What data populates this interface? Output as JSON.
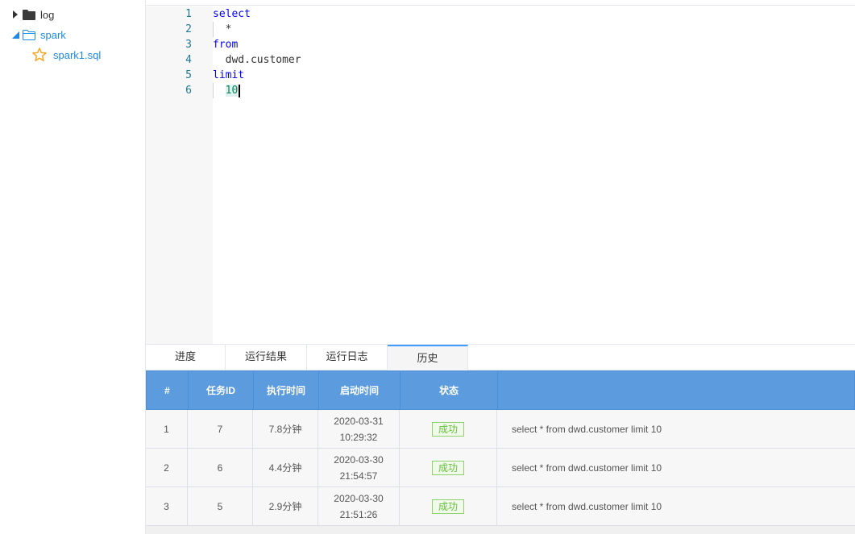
{
  "tree": {
    "items": [
      {
        "label": "log",
        "icon": "folder-filled-icon"
      },
      {
        "label": "spark",
        "icon": "folder-outline-icon"
      },
      {
        "label": "spark1.sql",
        "icon": "star-icon"
      }
    ]
  },
  "editor": {
    "line_numbers": [
      "1",
      "2",
      "3",
      "4",
      "5",
      "6"
    ],
    "lines": {
      "l1": "select",
      "l2": "  *",
      "l3": "from",
      "l4": "  dwd.customer",
      "l5": "limit",
      "l6_indent": "  ",
      "l6_value": "10"
    }
  },
  "tabs": [
    "进度",
    "运行结果",
    "运行日志",
    "历史"
  ],
  "active_tab": "历史",
  "table": {
    "headers": [
      "#",
      "任务ID",
      "执行时间",
      "启动时间",
      "状态",
      ""
    ],
    "rows": [
      {
        "idx": "1",
        "task_id": "7",
        "duration": "7.8分钟",
        "start_date": "2020-03-31",
        "start_time": "10:29:32",
        "status": "成功",
        "sql": "select * from dwd.customer limit 10"
      },
      {
        "idx": "2",
        "task_id": "6",
        "duration": "4.4分钟",
        "start_date": "2020-03-30",
        "start_time": "21:54:57",
        "status": "成功",
        "sql": "select * from dwd.customer limit 10"
      },
      {
        "idx": "3",
        "task_id": "5",
        "duration": "2.9分钟",
        "start_date": "2020-03-30",
        "start_time": "21:51:26",
        "status": "成功",
        "sql": "select * from dwd.customer limit 10"
      }
    ]
  },
  "colors": {
    "header_blue": "#5b9bde",
    "link_blue": "#1e88e5",
    "success_green": "#67c23a",
    "star_orange": "#f5a623"
  }
}
